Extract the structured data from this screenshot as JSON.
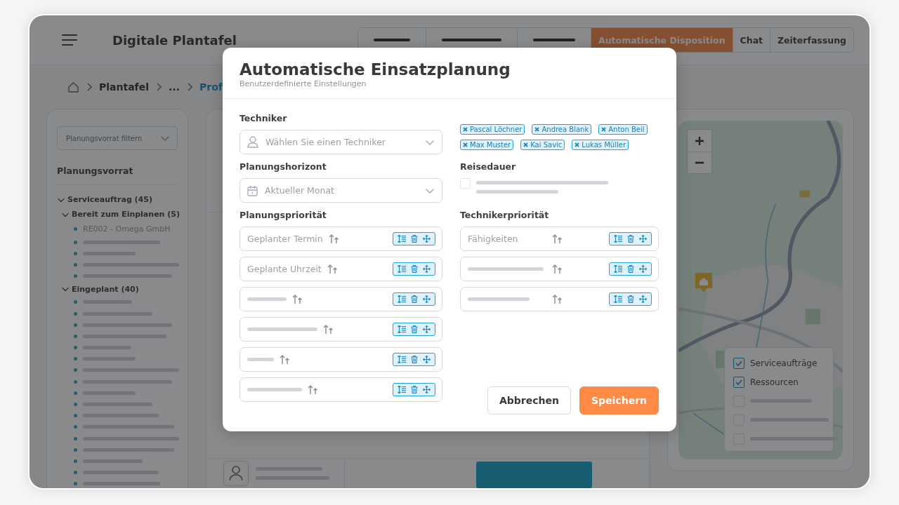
{
  "header": {
    "title": "Digitale Plantafel",
    "tabs": [
      {
        "kind": "placeholder",
        "selected": false
      },
      {
        "kind": "placeholder",
        "selected": false
      },
      {
        "kind": "placeholder",
        "selected": false
      },
      {
        "kind": "text",
        "label": "Automatische Disposition",
        "selected": true
      },
      {
        "kind": "text",
        "label": "Chat",
        "selected": false
      },
      {
        "kind": "text",
        "label": "Zeiterfassung",
        "selected": false
      }
    ]
  },
  "breadcrumb": [
    "Plantafel",
    "...",
    "Prof"
  ],
  "sidebar": {
    "filter": {
      "placeholder": "Planungsvorrat filtern"
    },
    "heading": "Planungsvorrat",
    "tree": [
      {
        "kind": "group",
        "label": "Serviceauftrag (45)",
        "expanded": true,
        "children": [
          {
            "kind": "group",
            "label": "Bereit zum Einplanen (5)",
            "expanded": true,
            "children": [
              {
                "kind": "text",
                "label": "RE002 - Omega GmbH"
              },
              {
                "kind": "placeholder"
              },
              {
                "kind": "placeholder"
              },
              {
                "kind": "placeholder"
              },
              {
                "kind": "placeholder"
              }
            ]
          },
          {
            "kind": "group",
            "label": "Eingeplant (40)",
            "expanded": true,
            "children": [
              {
                "kind": "placeholder"
              },
              {
                "kind": "placeholder"
              },
              {
                "kind": "placeholder"
              },
              {
                "kind": "placeholder"
              },
              {
                "kind": "placeholder"
              },
              {
                "kind": "placeholder"
              },
              {
                "kind": "placeholder"
              },
              {
                "kind": "placeholder"
              },
              {
                "kind": "placeholder"
              },
              {
                "kind": "placeholder"
              },
              {
                "kind": "placeholder"
              },
              {
                "kind": "placeholder"
              },
              {
                "kind": "placeholder"
              },
              {
                "kind": "placeholder"
              },
              {
                "kind": "placeholder"
              },
              {
                "kind": "placeholder"
              },
              {
                "kind": "placeholder"
              }
            ]
          }
        ]
      }
    ]
  },
  "map": {
    "legend": [
      {
        "kind": "text",
        "label": "Serviceaufträge",
        "checked": true
      },
      {
        "kind": "text",
        "label": "Ressourcen",
        "checked": true
      },
      {
        "kind": "placeholder",
        "checked": false
      },
      {
        "kind": "placeholder",
        "checked": false
      },
      {
        "kind": "placeholder",
        "checked": false
      }
    ]
  },
  "dialog": {
    "title": "Automatische Einsatzplanung",
    "subtitle": "Benutzerdefinierte Einstellungen",
    "technician": {
      "label": "Techniker",
      "placeholder": "Wählen Sie einen Techniker",
      "chips": [
        "Pascal Löchner",
        "Andrea Blank",
        "Anton Beil",
        "Max Muster",
        "Kai Savic",
        "Lukas Müller"
      ]
    },
    "horizon": {
      "label": "Planungshorizont",
      "value": "Aktueller Monat"
    },
    "travel": {
      "label": "Reisedauer",
      "checked": false
    },
    "planning_priority": {
      "label": "Planungspriorität",
      "items": [
        {
          "kind": "text",
          "label": "Geplanter Termin"
        },
        {
          "kind": "text",
          "label": "Geplante Uhrzeit"
        },
        {
          "kind": "placeholder"
        },
        {
          "kind": "placeholder"
        },
        {
          "kind": "placeholder"
        },
        {
          "kind": "placeholder"
        }
      ]
    },
    "technician_priority": {
      "label": "Technikerpriorität",
      "items": [
        {
          "kind": "text",
          "label": "Fähigkeiten"
        },
        {
          "kind": "placeholder"
        },
        {
          "kind": "placeholder"
        }
      ]
    },
    "buttons": [
      {
        "kind": "secondary",
        "label": "Abbrechen"
      },
      {
        "kind": "primary",
        "label": "Speichern"
      }
    ]
  }
}
